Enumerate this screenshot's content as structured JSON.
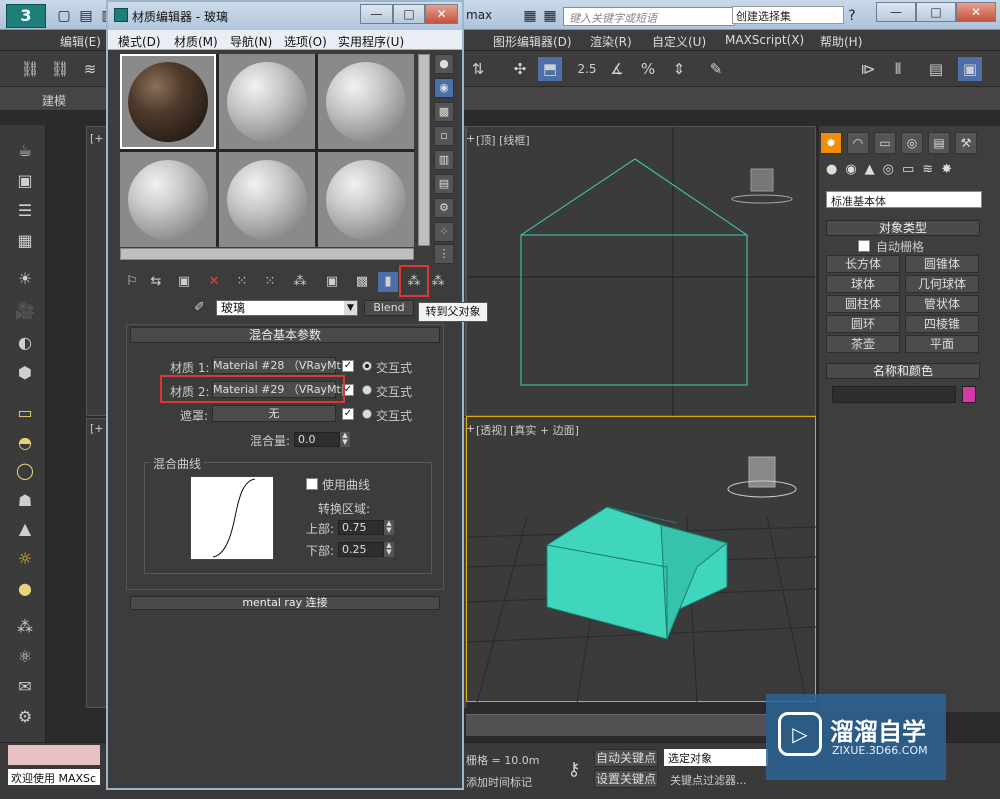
{
  "app": {
    "logo_text": "3",
    "title_suffix": "max",
    "search_placeholder": "键入关键字或短语",
    "window_buttons": [
      "—",
      "□",
      "✕"
    ]
  },
  "menubar": {
    "items": [
      "编辑(E)",
      "图形编辑器(D)",
      "渲染(R)",
      "自定义(U)",
      "MAXScript(X)",
      "帮助(H)"
    ]
  },
  "toolbar": {
    "selection_set": "创建选择集",
    "snap_value": "2.5"
  },
  "ribbon": {
    "tab": "建模"
  },
  "viewports": {
    "top_right_label": "[顶] [线框]",
    "top_right_prefix": "+",
    "bottom_right_label": "[透视] [真实 + 边面]",
    "bottom_right_prefix": "+",
    "left_label_top": "[+",
    "left_label_bottom": "[+"
  },
  "command_panel": {
    "tabs": [
      "✸",
      "◠",
      "▭",
      "◎",
      "▤",
      "⚒"
    ],
    "dropdown": "标准基本体",
    "object_type_header": "对象类型",
    "autogrid_label": "自动栅格",
    "buttons": [
      "长方体",
      "圆锥体",
      "球体",
      "几何球体",
      "圆柱体",
      "管状体",
      "圆环",
      "四棱锥",
      "茶壶",
      "平面"
    ],
    "name_color_header": "名称和颜色",
    "swatch_color": "#d63aa8"
  },
  "bottom": {
    "welcome": "欢迎使用 MAXSc",
    "grid_label": "栅格 = 10.0m",
    "auto_key": "自动关键点",
    "set_key": "设置关键点",
    "selected_object": "选定对象",
    "key_filter": "关键点过滤器...",
    "add_time_tag": "添加时间标记"
  },
  "material_editor": {
    "title": "材质编辑器 - 玻璃",
    "menu": [
      "模式(D)",
      "材质(M)",
      "导航(N)",
      "选项(O)",
      "实用程序(U)"
    ],
    "material_name": "玻璃",
    "material_type": "Blend",
    "tooltip": "转到父对象",
    "blend_params": {
      "header": "混合基本参数",
      "material1_label": "材质 1:",
      "material1_value": "Material #28 （VRayMtl）",
      "material2_label": "材质 2:",
      "material2_value": "Material #29 （VRayMtl）",
      "mask_label": "遮罩:",
      "mask_value": "无",
      "interactive_label": "交互式",
      "mix_amount_label": "混合量:",
      "mix_amount": "0.0",
      "curve_group_label": "混合曲线",
      "use_curve_label": "使用曲线",
      "transition_label": "转换区域:",
      "upper_label": "上部:",
      "upper_value": "0.75",
      "lower_label": "下部:",
      "lower_value": "0.25"
    },
    "mental_ray_header": "mental ray 连接"
  },
  "watermark": {
    "title": "溜溜自学",
    "url": "ZIXUE.3D66.COM"
  }
}
